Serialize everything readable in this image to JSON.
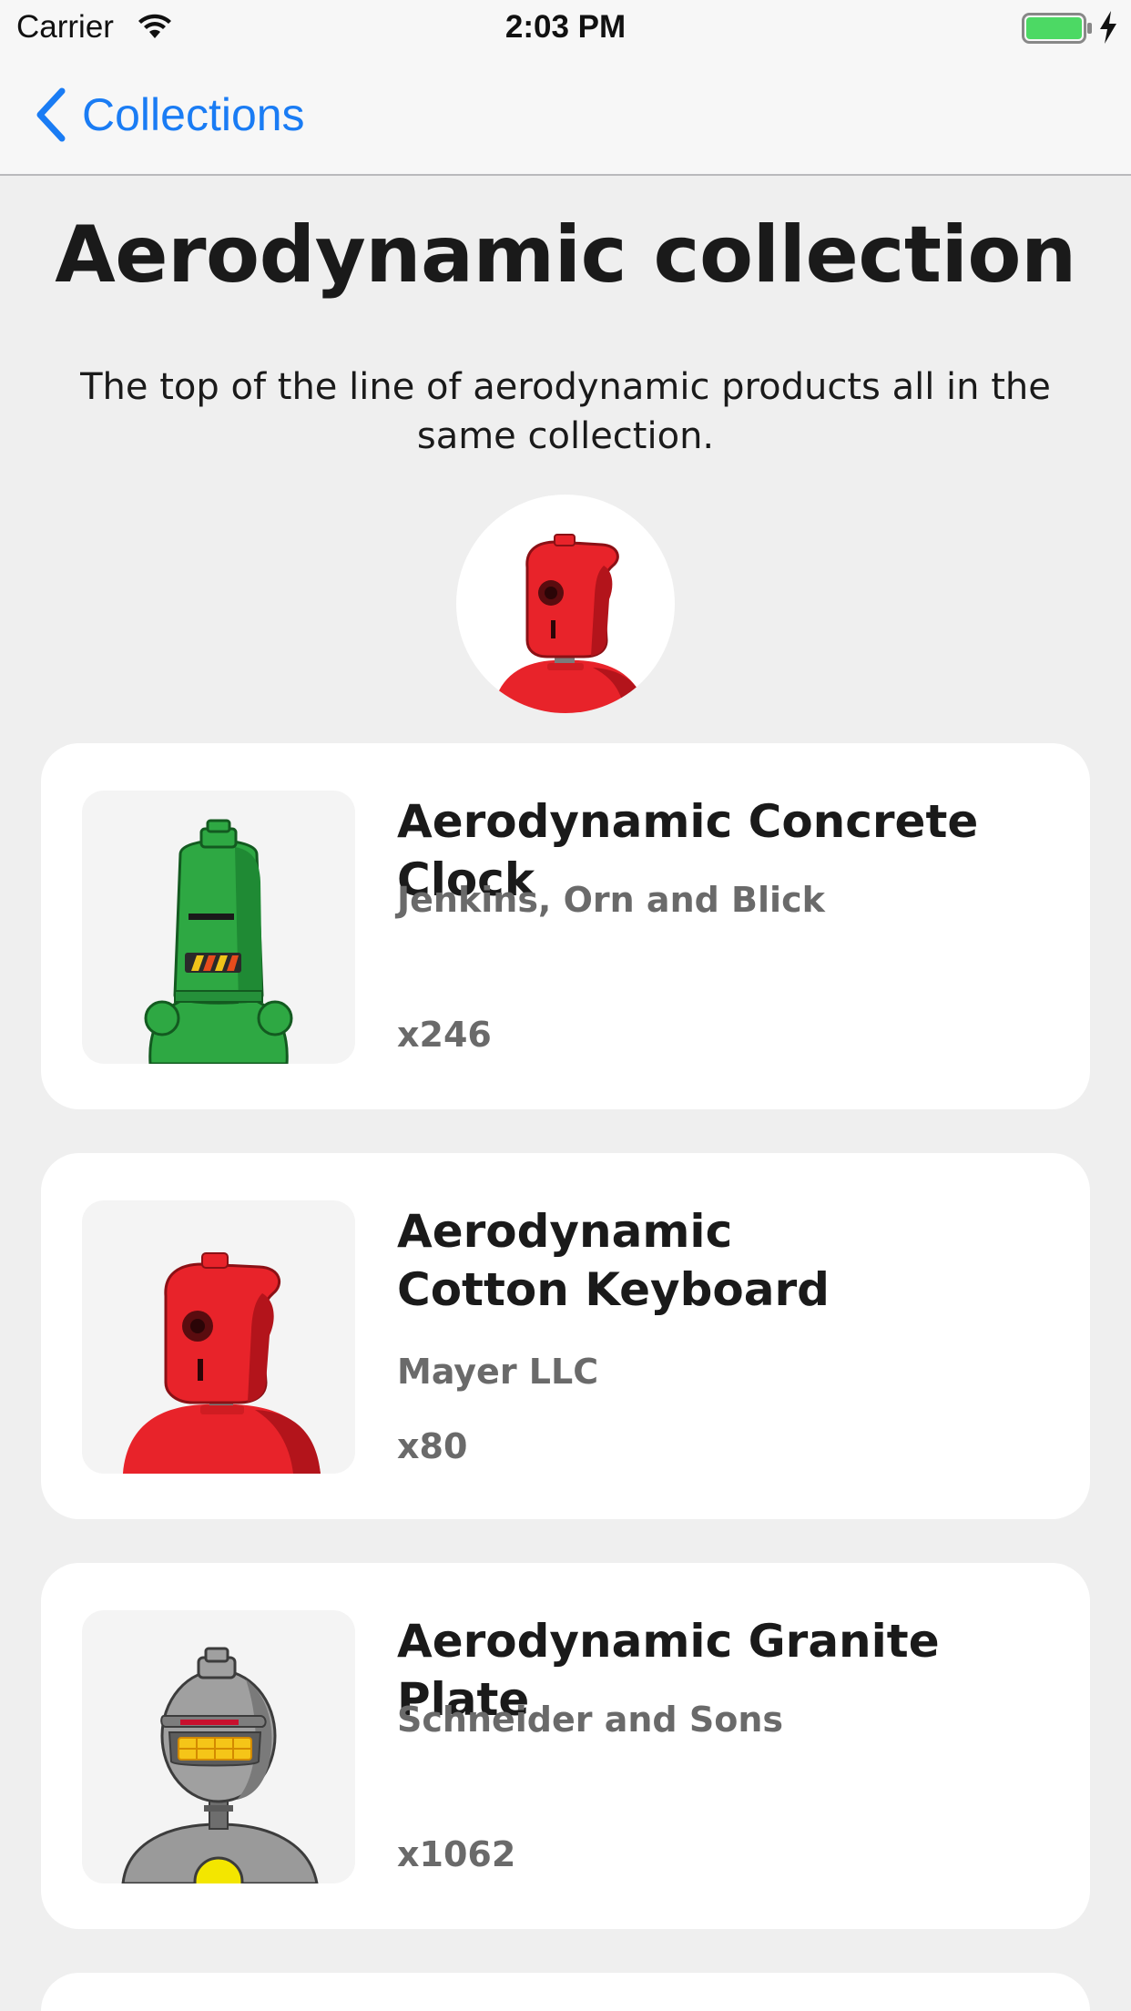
{
  "status_bar": {
    "carrier": "Carrier",
    "time": "2:03 PM",
    "battery_color": "#4cd964"
  },
  "nav": {
    "back_label": "Collections",
    "back_icon": "chevron-left-icon",
    "accent_color": "#1a7cf4"
  },
  "collection": {
    "title": "Aerodynamic collection",
    "description": "The top of the line of aerodynamic products all in the same collection.",
    "avatar_icon": "red-robot-icon"
  },
  "products": [
    {
      "title_lines": [
        "Aerodynamic Concrete Clock"
      ],
      "maker": "Jenkins, Orn and Blick",
      "quantity": "x246",
      "image_icon": "green-robot-icon"
    },
    {
      "title_lines": [
        "Aerodynamic",
        "Cotton Keyboard"
      ],
      "maker": "Mayer LLC",
      "quantity": "x80",
      "image_icon": "red-robot-icon"
    },
    {
      "title_lines": [
        "Aerodynamic Granite Plate"
      ],
      "maker": "Schneider and Sons",
      "quantity": "x1062",
      "image_icon": "gray-robot-icon"
    }
  ]
}
